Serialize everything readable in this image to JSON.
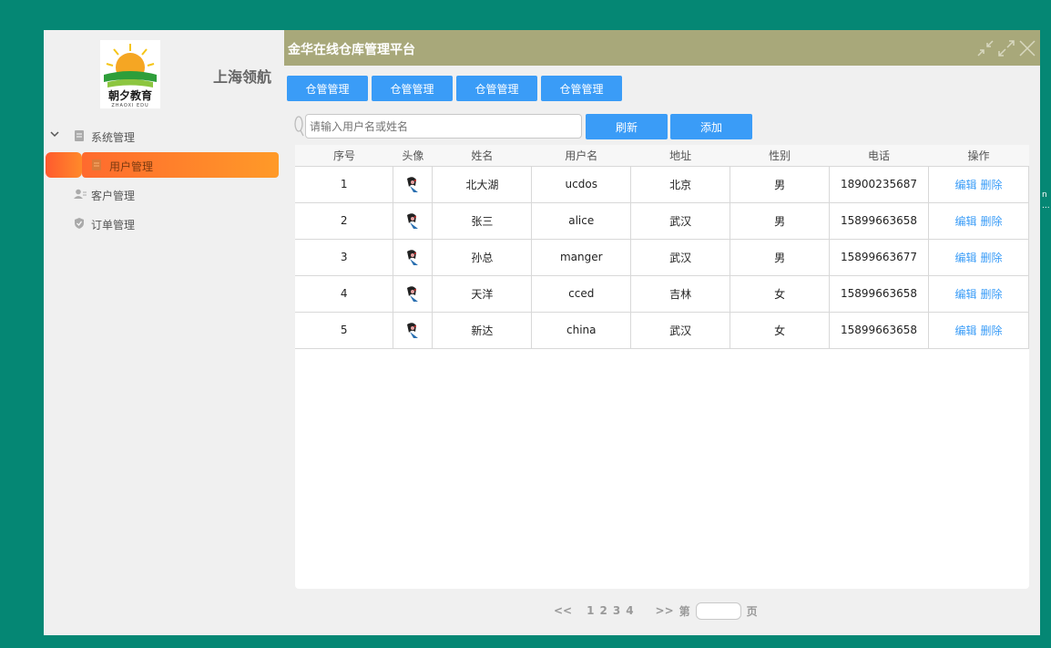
{
  "sidebar": {
    "logo_text": "朝夕教育",
    "logo_sub": "ZHAOXI EDU",
    "brand": "上海领航",
    "menu": [
      {
        "label": "系统管理",
        "icon": "document-icon"
      },
      {
        "label": "用户管理",
        "icon": "document-icon",
        "active": true
      },
      {
        "label": "客户管理",
        "icon": "users-icon"
      },
      {
        "label": "订单管理",
        "icon": "shield-icon"
      }
    ]
  },
  "header": {
    "title": "金华在线仓库管理平台"
  },
  "tabs": [
    "仓管管理",
    "仓管管理",
    "仓管管理",
    "仓管管理"
  ],
  "search": {
    "placeholder": "请输入用户名或姓名",
    "refresh_label": "刷新",
    "add_label": "添加"
  },
  "table": {
    "columns": [
      "序号",
      "头像",
      "姓名",
      "用户名",
      "地址",
      "性别",
      "电话",
      "操作"
    ],
    "rows": [
      [
        "1",
        "北大湖",
        "ucdos",
        "北京",
        "男",
        "18900235687"
      ],
      [
        "2",
        "张三",
        "alice",
        "武汉",
        "男",
        "15899663658"
      ],
      [
        "3",
        "孙总",
        "manger",
        "武汉",
        "男",
        "15899663677"
      ],
      [
        "4",
        "天洋",
        "cced",
        "吉林",
        "女",
        "15899663658"
      ],
      [
        "5",
        "新达",
        "china",
        "武汉",
        "女",
        "15899663658"
      ]
    ],
    "edit_label": "编辑",
    "delete_label": "删除"
  },
  "pager": {
    "prev": "<<",
    "pages": [
      "1",
      "2",
      "3",
      "4"
    ],
    "next": ">>",
    "prefix": "第",
    "suffix": "页"
  },
  "edge_text": [
    "n",
    "..."
  ],
  "colors": {
    "background": "#058774",
    "header": "#a8a87a",
    "accent": "#3a9cf7",
    "active_gradient_start": "#ff5a2e",
    "active_gradient_end": "#ff9a28"
  }
}
